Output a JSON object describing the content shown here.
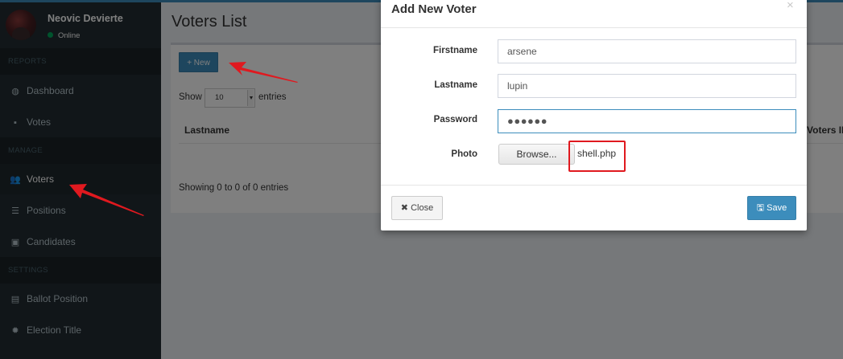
{
  "user": {
    "name": "Neovic Devierte",
    "status": "Online"
  },
  "sidebar": {
    "sections": [
      {
        "header": "REPORTS"
      },
      {
        "header": "MANAGE"
      },
      {
        "header": "SETTINGS"
      }
    ],
    "items": [
      {
        "label": "Dashboard",
        "icon": "dashboard-icon",
        "glyph": "◍"
      },
      {
        "label": "Votes",
        "icon": "lock-icon",
        "glyph": "▪"
      },
      {
        "label": "Voters",
        "icon": "users-icon",
        "glyph": "👥"
      },
      {
        "label": "Positions",
        "icon": "tasks-icon",
        "glyph": "☰"
      },
      {
        "label": "Candidates",
        "icon": "id-card-icon",
        "glyph": "▣"
      },
      {
        "label": "Ballot Position",
        "icon": "file-icon",
        "glyph": "▤"
      },
      {
        "label": "Election Title",
        "icon": "cog-icon",
        "glyph": "✹"
      }
    ]
  },
  "main": {
    "title": "Voters List",
    "new_button": "+ New",
    "show_label": "Show",
    "page_size": "10",
    "entries_label": "entries",
    "columns": [
      "Lastname",
      "Voters ID"
    ],
    "info": "Showing 0 to 0 of 0 entries"
  },
  "modal": {
    "title": "Add New Voter",
    "close_glyph": "×",
    "fields": [
      {
        "label": "Firstname",
        "value": "arsene"
      },
      {
        "label": "Lastname",
        "value": "lupin"
      },
      {
        "label": "Password",
        "value": "●●●●●●"
      },
      {
        "label": "Photo",
        "browse": "Browse...",
        "file": "shell.php"
      }
    ],
    "close_button": "✖ Close",
    "save_button": "🖫 Save"
  },
  "colors": {
    "primary": "#3c8dbc",
    "sidebar": "#222d32",
    "annotation": "#e0191f"
  }
}
